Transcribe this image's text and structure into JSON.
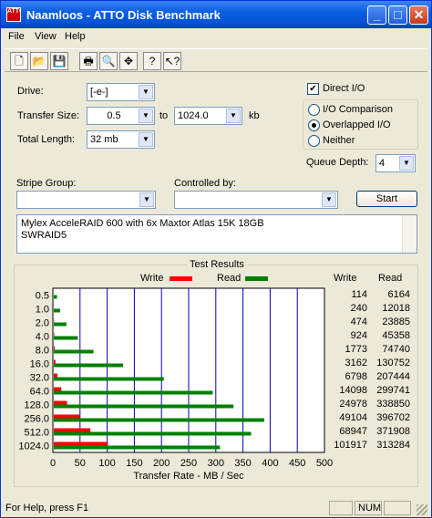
{
  "window": {
    "title": "Naamloos - ATTO Disk Benchmark",
    "icon_text": "ATTO",
    "minimize_glyph": "_",
    "maximize_glyph": "□",
    "close_glyph": "✕"
  },
  "menu": [
    "File",
    "View",
    "Help"
  ],
  "toolbar": {
    "icons": [
      "new-document-icon",
      "open-folder-icon",
      "save-icon",
      "print-icon",
      "print-preview-icon",
      "move-icon",
      "help-icon",
      "context-help-icon"
    ],
    "glyphs": [
      "🗋",
      "📂",
      "💾",
      "🖶",
      "🔍",
      "✥",
      "?",
      "↖?"
    ]
  },
  "settings": {
    "drive_label": "Drive:",
    "drive_value": "[-e-]",
    "transfer_size_label": "Transfer Size:",
    "transfer_from": "0.5",
    "to_label": "to",
    "transfer_to": "1024.0",
    "kb_label": "kb",
    "total_length_label": "Total Length:",
    "total_length_value": "32 mb",
    "direct_io_label": "Direct I/O",
    "direct_io_checked": true,
    "io_comparison_label": "I/O Comparison",
    "overlapped_io_label": "Overlapped I/O",
    "neither_label": "Neither",
    "selected_mode": "Overlapped I/O",
    "queue_depth_label": "Queue Depth:",
    "queue_depth_value": "4",
    "stripe_group_label": "Stripe Group:",
    "stripe_group_value": "",
    "controlled_by_label": "Controlled by:",
    "controlled_by_value": "",
    "start_label": "Start",
    "description_line1": "Mylex AcceleRAID 600 with 6x Maxtor Atlas 15K 18GB",
    "description_line2": "SWRAID5"
  },
  "results": {
    "title": "Test Results",
    "write_label": "Write",
    "read_label": "Read",
    "write_color": "#ff0000",
    "read_color": "#008000",
    "write_col_header": "Write",
    "read_col_header": "Read",
    "rows": [
      {
        "size": "0.5",
        "write": "114",
        "read": "6164"
      },
      {
        "size": "1.0",
        "write": "240",
        "read": "12018"
      },
      {
        "size": "2.0",
        "write": "474",
        "read": "23885"
      },
      {
        "size": "4.0",
        "write": "924",
        "read": "45358"
      },
      {
        "size": "8.0",
        "write": "1773",
        "read": "74740"
      },
      {
        "size": "16.0",
        "write": "3162",
        "read": "130752"
      },
      {
        "size": "32.0",
        "write": "6798",
        "read": "207444"
      },
      {
        "size": "64.0",
        "write": "14098",
        "read": "299741"
      },
      {
        "size": "128.0",
        "write": "24978",
        "read": "338850"
      },
      {
        "size": "256.0",
        "write": "49104",
        "read": "396702"
      },
      {
        "size": "512.0",
        "write": "68947",
        "read": "371908"
      },
      {
        "size": "1024.0",
        "write": "101917",
        "read": "313284"
      }
    ]
  },
  "chart_data": {
    "type": "bar",
    "categories": [
      "0.5",
      "1.0",
      "2.0",
      "4.0",
      "8.0",
      "16.0",
      "32.0",
      "64.0",
      "128.0",
      "256.0",
      "512.0",
      "1024.0"
    ],
    "series": [
      {
        "name": "Write",
        "values": [
          0.1,
          0.2,
          0.5,
          0.9,
          1.7,
          3.1,
          6.6,
          13.8,
          24.4,
          48.0,
          67.3,
          99.5
        ]
      },
      {
        "name": "Read",
        "values": [
          6.0,
          11.7,
          23.3,
          44.3,
          73.0,
          127.7,
          202.6,
          292.7,
          330.9,
          387.4,
          363.2,
          305.9
        ]
      }
    ],
    "xlabel": "Transfer Rate - MB / Sec",
    "xlim": [
      0,
      500
    ],
    "x_ticks": [
      "0",
      "50",
      "100",
      "150",
      "200",
      "250",
      "300",
      "350",
      "400",
      "450",
      "500"
    ],
    "grid": true,
    "orientation": "horizontal"
  },
  "status": {
    "text": "For Help, press F1",
    "num": "NUM"
  }
}
